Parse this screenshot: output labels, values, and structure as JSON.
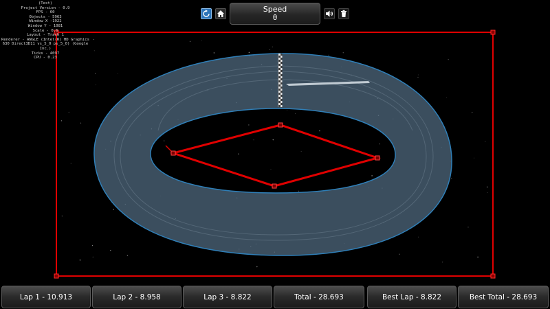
{
  "debug": {
    "lines": [
      "(Test)",
      "Project Version - 0.9",
      "FPS - 60",
      "Objects - 5963",
      "Window X -1922",
      "Window Y - 1081",
      "Scale - 0.6",
      "Layout - Track 1",
      "Renderer - ANGLE (Intel(R) HD Graphics 630 Direct3D11 vs_5_0 ps_5_0) (Google Inc.)",
      "Ticks - 4097",
      "CPU - 0.23"
    ]
  },
  "toolbar": {
    "restart_icon": "restart-icon",
    "home_icon": "home-icon",
    "sound_icon": "speaker-icon",
    "reset_icon": "trash-icon"
  },
  "speed": {
    "label": "Speed",
    "value": "0"
  },
  "laps": [
    {
      "text": "Lap 1 - 10.913"
    },
    {
      "text": "Lap 2 - 8.958"
    },
    {
      "text": "Lap 3 - 8.822"
    },
    {
      "text": "Total - 28.693"
    },
    {
      "text": "Best Lap - 8.822"
    },
    {
      "text": "Best Total - 28.693"
    }
  ],
  "colors": {
    "background": "#000000",
    "track_fill": "#4b6479",
    "track_edge": "#2f7fb8",
    "boundary": "#e00000",
    "path": "#e00000",
    "accent_button": "#2d74b8"
  }
}
